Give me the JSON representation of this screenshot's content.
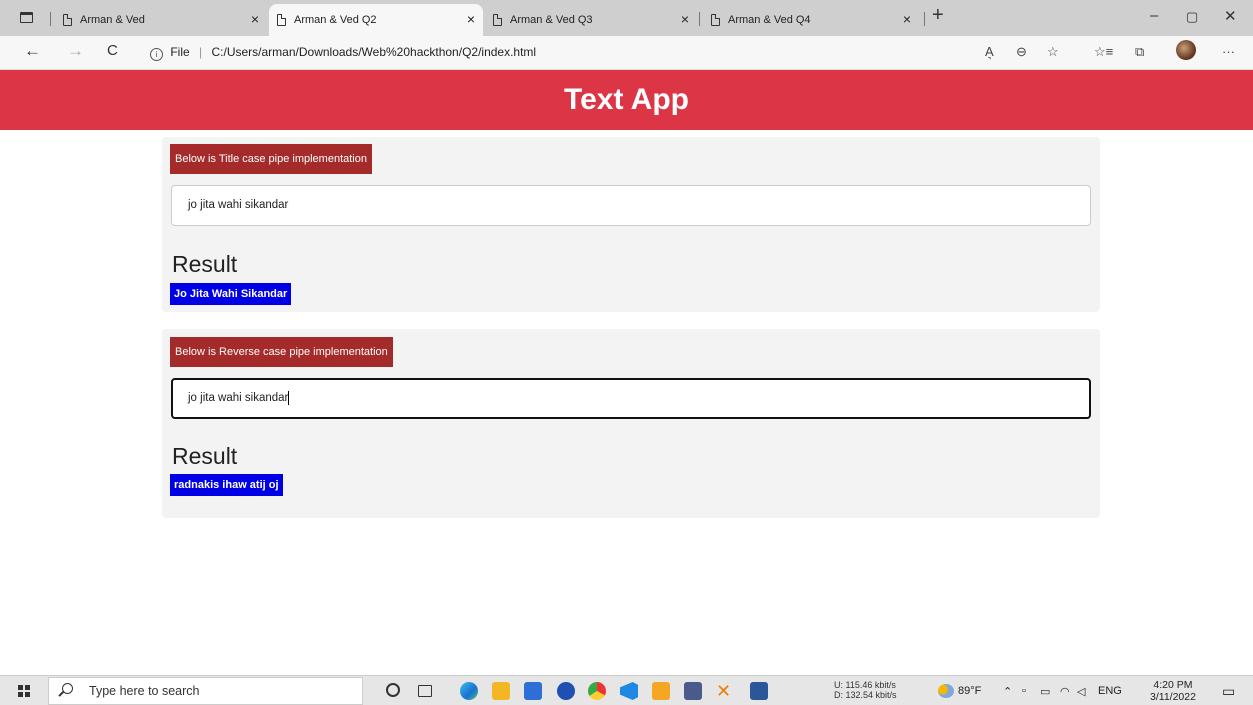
{
  "browser": {
    "tabs": [
      {
        "label": "Arman & Ved",
        "active": false
      },
      {
        "label": "Arman & Ved Q2",
        "active": true
      },
      {
        "label": "Arman & Ved Q3",
        "active": false
      },
      {
        "label": "Arman & Ved Q4",
        "active": false
      }
    ],
    "tab_close": "×",
    "new_tab": "+",
    "window": {
      "minimize": "–",
      "restore": "▢",
      "close": "✕"
    },
    "nav": {
      "back": "←",
      "forward": "→",
      "refresh": "C"
    },
    "address": {
      "info_icon": "i",
      "protocol": "File",
      "url": "C:/Users/arman/Downloads/Web%20hackthon/Q2/index.html"
    },
    "toolbar_icons": {
      "read_aloud": "A͉",
      "zoom": "⊖",
      "favorite": "☆",
      "favorites_list": "☆≡",
      "collections": "⧉",
      "more": "···"
    }
  },
  "page": {
    "header_title": "Text App",
    "sections": [
      {
        "label": "Below is Title case pipe implementation",
        "input_value": "jo jita wahi sikandar",
        "result_heading": "Result",
        "result_value": "Jo Jita Wahi Sikandar"
      },
      {
        "label": "Below is Reverse case pipe implementation",
        "input_value": "jo jita wahi sikandar",
        "result_heading": "Result",
        "result_value": "radnakis ihaw atij oj"
      }
    ]
  },
  "taskbar": {
    "search_placeholder": "Type here to search",
    "network_upload": "U:  115.46 kbit/s",
    "network_download": "D:  132.54 kbit/s",
    "weather": "89°F",
    "language": "ENG",
    "time": "4:20 PM",
    "date": "3/11/2022"
  },
  "colors": {
    "header": "#dc3545",
    "label_badge": "#a52a2a",
    "result_badge": "#0000e6"
  }
}
